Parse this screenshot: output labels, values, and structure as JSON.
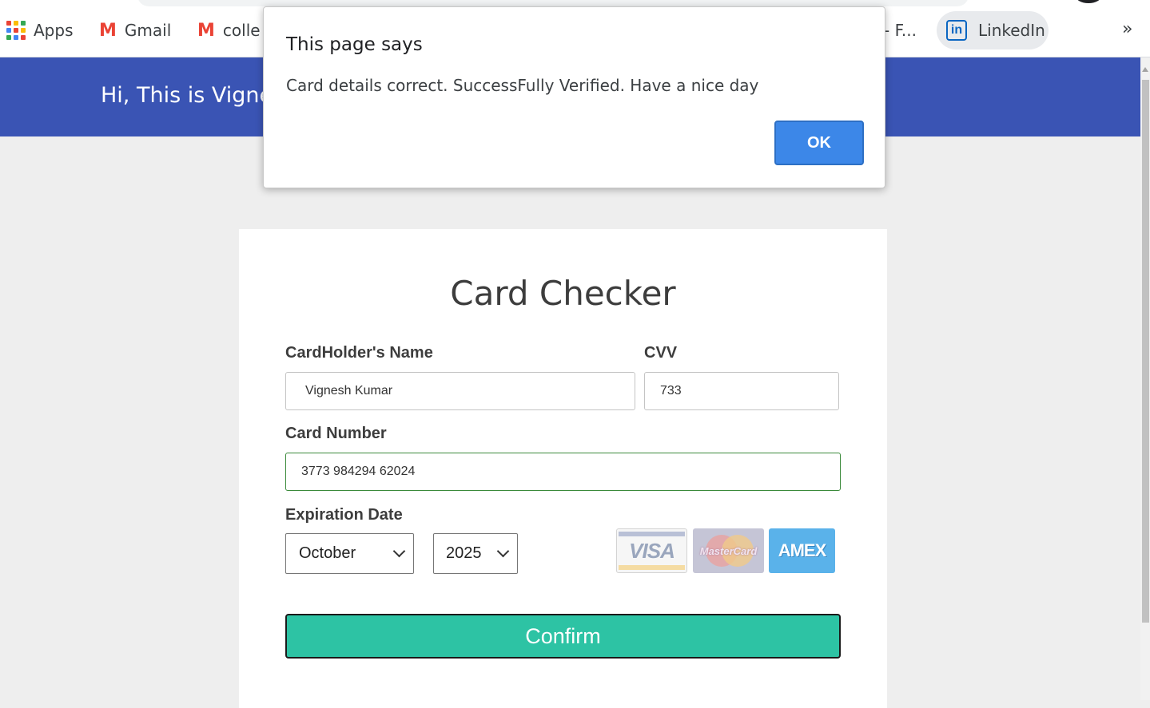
{
  "bookmarks": {
    "apps_label": "Apps",
    "gmail_label": "Gmail",
    "college_label": "colle",
    "truncated_label": "- F...",
    "linkedin_label": "LinkedIn",
    "linkedin_icon_text": "in",
    "gmail_icon_text": "M",
    "more_label": "»",
    "apps_grid_colors": [
      "#ea4335",
      "#fbbc04",
      "#34a853",
      "#4285f4",
      "#ea4335",
      "#fbbc04",
      "#34a853",
      "#4285f4",
      "#ea4335"
    ]
  },
  "header": {
    "greeting": "Hi, This is Vignes"
  },
  "card": {
    "title": "Card Checker",
    "cardholder_label": "CardHolder's Name",
    "cardholder_value": "Vignesh Kumar",
    "cvv_label": "CVV",
    "cvv_value": "733",
    "card_number_label": "Card Number",
    "card_number_value": "3773 984294 62024",
    "expiration_label": "Expiration Date",
    "month_value": "October",
    "year_value": "2025",
    "card_logos": {
      "visa": "VISA",
      "mastercard": "MasterCard",
      "amex": "AMEX"
    },
    "confirm_label": "Confirm",
    "confirm_color": "#2dc3a4"
  },
  "alert": {
    "title": "This page says",
    "message": "Card details correct. SuccessFully Verified. Have a nice day",
    "ok_label": "OK",
    "ok_color": "#3c87e8"
  },
  "colors": {
    "header_bg": "#3a54b4",
    "page_bg": "#eeeeee"
  }
}
